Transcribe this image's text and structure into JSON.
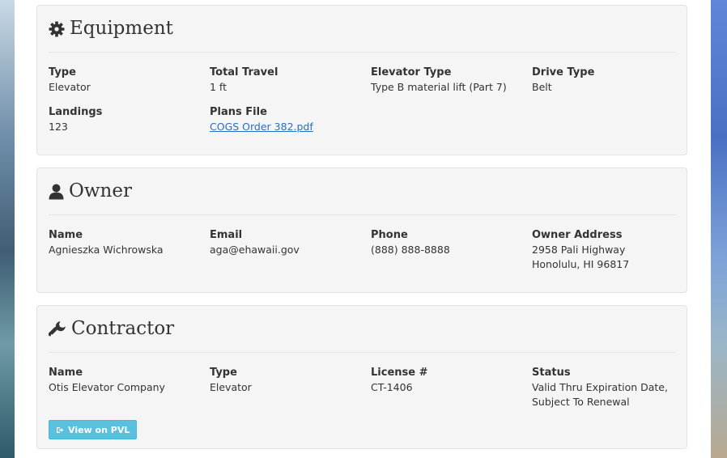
{
  "equipment": {
    "title": "Equipment",
    "icon": "gear-icon",
    "type_label": "Type",
    "type_value": "Elevator",
    "total_travel_label": "Total Travel",
    "total_travel_value": "1 ft",
    "elevator_type_label": "Elevator Type",
    "elevator_type_value": "Type B material lift (Part 7)",
    "drive_type_label": "Drive Type",
    "drive_type_value": "Belt",
    "landings_label": "Landings",
    "landings_value": "123",
    "plans_file_label": "Plans File",
    "plans_file_value": "COGS Order 382.pdf"
  },
  "owner": {
    "title": "Owner",
    "icon": "user-icon",
    "name_label": "Name",
    "name_value": "Agnieszka Wichrowska",
    "email_label": "Email",
    "email_value": "aga@ehawaii.gov",
    "phone_label": "Phone",
    "phone_value": "(888) 888-8888",
    "address_label": "Owner Address",
    "address_line1": "2958 Pali Highway",
    "address_line2": "Honolulu, HI 96817"
  },
  "contractor": {
    "title": "Contractor",
    "icon": "wrench-icon",
    "name_label": "Name",
    "name_value": "Otis Elevator Company",
    "type_label": "Type",
    "type_value": "Elevator",
    "license_label": "License #",
    "license_value": "CT-1406",
    "status_label": "Status",
    "status_line1": "Valid Thru Expiration Date,",
    "status_line2": "Subject To Renewal",
    "pvl_button_label": "View on PVL",
    "pvl_button_icon": "external-link-icon"
  },
  "colors": {
    "panel_bg": "#f5f5f5",
    "link": "#2a6ebd",
    "button_info": "#5bc0de"
  }
}
